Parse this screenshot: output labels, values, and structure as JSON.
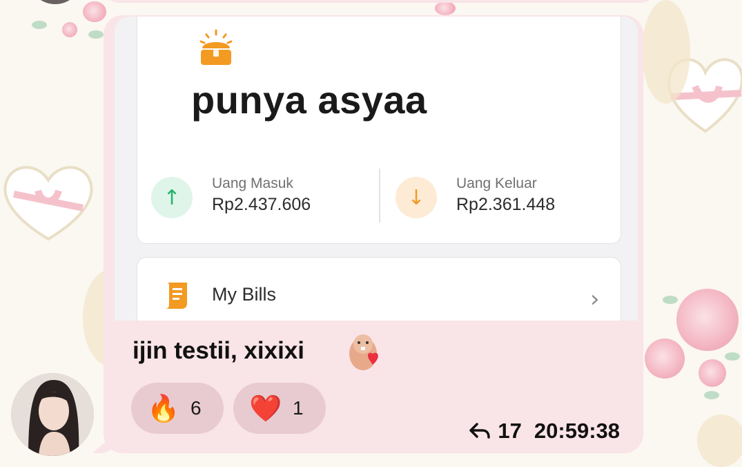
{
  "wallet": {
    "name": "punya asyaa",
    "income_label": "Uang Masuk",
    "income_value": "Rp2.437.606",
    "expense_label": "Uang Keluar",
    "expense_value": "Rp2.361.448",
    "bills_label": "My Bills"
  },
  "message": {
    "text": "ijin testii, xixixi",
    "reply_count": "17",
    "time": "20:59:38"
  },
  "reactions": [
    {
      "emoji": "🔥",
      "count": "6"
    },
    {
      "emoji": "❤️",
      "count": "1"
    }
  ],
  "colors": {
    "bubble": "#f9e4e8",
    "reaction_pill": "#e8cbd0",
    "income_accent": "#27b36b",
    "expense_accent": "#f39a22"
  },
  "icons": {
    "chest": "treasure-chest-icon",
    "income": "arrow-up-icon",
    "expense": "arrow-down-icon",
    "bills": "receipt-scroll-icon",
    "chevron": "chevron-right-icon",
    "reply": "reply-arrow-icon"
  }
}
